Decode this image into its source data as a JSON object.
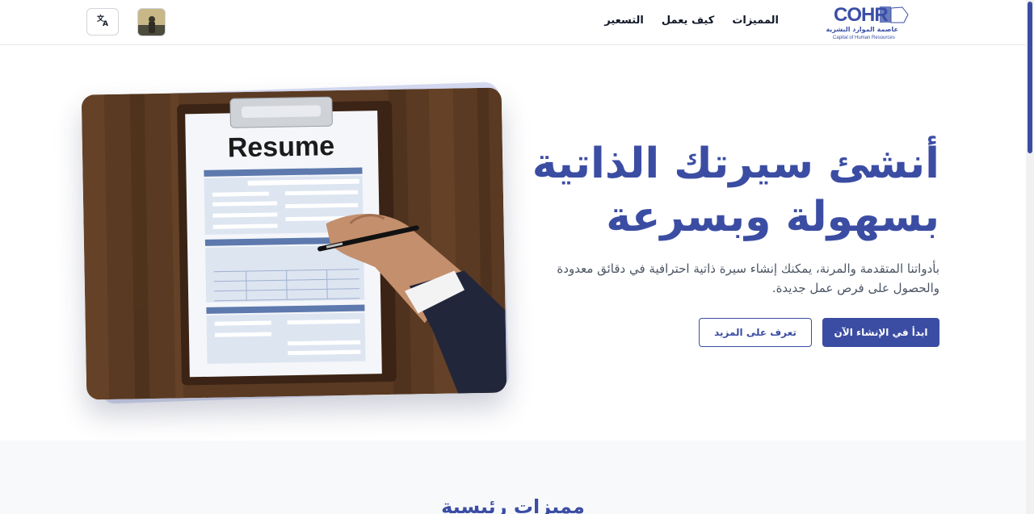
{
  "header": {
    "logo": {
      "wordmark": "COHR",
      "arabic_name": "عاصمة الموارد البشرية",
      "english_name": "Capital of Human Resources"
    },
    "nav": [
      {
        "label": "المميزات"
      },
      {
        "label": "كيف يعمل"
      },
      {
        "label": "التسعير"
      }
    ],
    "language_icon": "translate-icon",
    "avatar_alt": "user-avatar"
  },
  "hero": {
    "title_line1": "أنشئ سيرتك الذاتية",
    "title_line2": "بسهولة وبسرعة",
    "description": "بأدواتنا المتقدمة والمرنة، يمكنك إنشاء سيرة ذاتية احترافية في دقائق معدودة والحصول على فرص عمل جديدة.",
    "primary_button": "ابدأ في الإنشاء الآن",
    "secondary_button": "تعرف على المزيد",
    "image_text": "Resume"
  },
  "features": {
    "title": "مميزات رئيسية"
  },
  "colors": {
    "primary": "#3b4da3",
    "background": "#ffffff",
    "section_bg": "#f8f9fb"
  }
}
